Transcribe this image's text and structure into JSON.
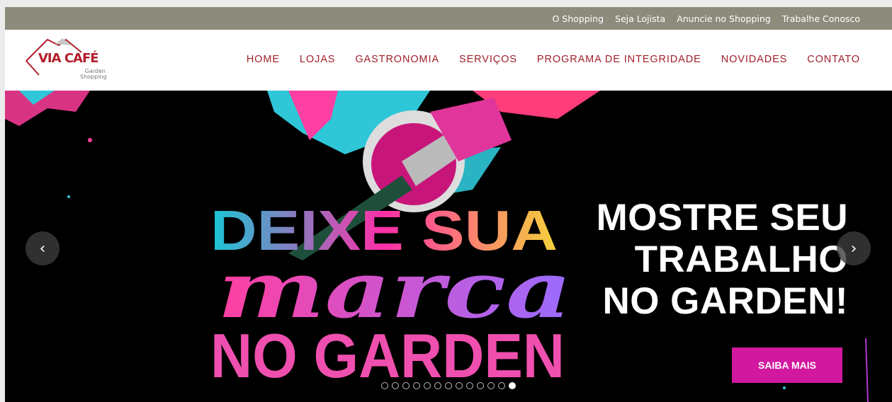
{
  "topbar": {
    "links": [
      "O Shopping",
      "Seja Lojista",
      "Anuncie no Shopping",
      "Trabalhe Conosco"
    ]
  },
  "logo": {
    "main": "VIA CAFÉ",
    "sub_line1": "Garden",
    "sub_line2": "Shopping"
  },
  "nav": {
    "items": [
      "HOME",
      "LOJAS",
      "GASTRONOMIA",
      "SERVIÇOS",
      "PROGRAMA DE INTEGRIDADE",
      "NOVIDADES",
      "CONTATO"
    ]
  },
  "slide": {
    "art_line1": "DEIXE SUA",
    "art_line2": "marca",
    "art_line3": "NO GARDEN",
    "headline_line1": "MOSTRE SEU",
    "headline_line2": "TRABALHO",
    "headline_line3": "NO GARDEN!",
    "cta_label": "SAIBA MAIS",
    "prev_icon": "chevron-left-icon",
    "next_icon": "chevron-right-icon",
    "prev_glyph": "‹",
    "next_glyph": "›",
    "dot_count": 13,
    "active_dot": 12
  },
  "colors": {
    "topbar_bg": "#8d8c7c",
    "nav_text": "#a01f28",
    "logo_red": "#b31e2c",
    "cta_bg": "#d2189f",
    "slide_bg": "#000000"
  }
}
